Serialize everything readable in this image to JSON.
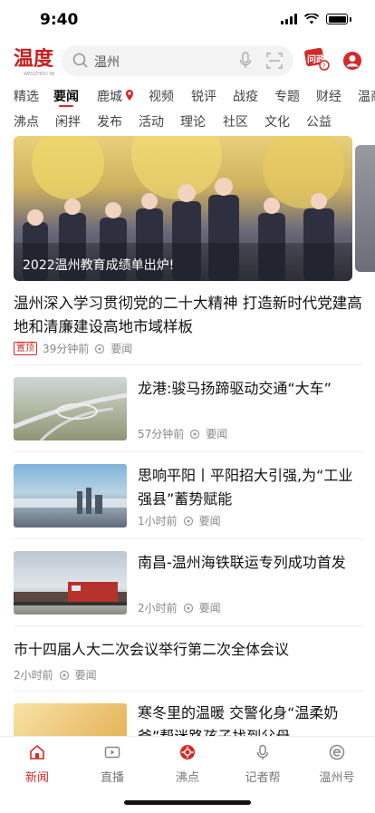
{
  "status": {
    "time": "9:40"
  },
  "header": {
    "logo_text": "温度",
    "logo_sub": "WENZHOU NEWS",
    "search_placeholder": "温州",
    "ask_label": "问政"
  },
  "channels_row1": [
    "精选",
    "要闻",
    "鹿城",
    "视频",
    "锐评",
    "战疫",
    "专题",
    "财经",
    "温商"
  ],
  "channels_row2": [
    "沸点",
    "闲拌",
    "发布",
    "活动",
    "理论",
    "社区",
    "文化",
    "公益"
  ],
  "active_channel": "要闻",
  "banner": {
    "caption": "2022温州教育成绩单出炉!"
  },
  "lead": {
    "title": "温州深入学习贯彻党的二十大精神 打造新时代党建高地和清廉建设高地市域样板",
    "badge": "置顶",
    "time": "39分钟前",
    "channel": "要闻"
  },
  "items": [
    {
      "title": "龙港:骏马扬蹄驱动交通“大车”",
      "time": "57分钟前",
      "channel": "要闻"
    },
    {
      "title": "思响平阳丨平阳招大引强,为“工业强县”蓄势赋能",
      "time": "1小时前",
      "channel": "要闻"
    },
    {
      "title": "南昌-温州海铁联运专列成功首发",
      "time": "2小时前",
      "channel": "要闻"
    },
    {
      "title": "寒冬里的温暖 交警化身“温柔奶爸”帮迷路孩子找到父母",
      "time": "",
      "channel": ""
    }
  ],
  "text_item": {
    "title": "市十四届人大二次会议举行第二次全体会议",
    "time": "2小时前",
    "channel": "要闻"
  },
  "tabbar": [
    {
      "label": "新闻",
      "icon": "home-icon",
      "active": true
    },
    {
      "label": "直播",
      "icon": "tv-icon",
      "active": false
    },
    {
      "label": "沸点",
      "icon": "hotspot-icon",
      "active": false
    },
    {
      "label": "记者帮",
      "icon": "mic-icon",
      "active": false
    },
    {
      "label": "温州号",
      "icon": "e-icon",
      "active": false
    }
  ],
  "colors": {
    "accent": "#d32a2a",
    "meta_text": "#888888"
  }
}
